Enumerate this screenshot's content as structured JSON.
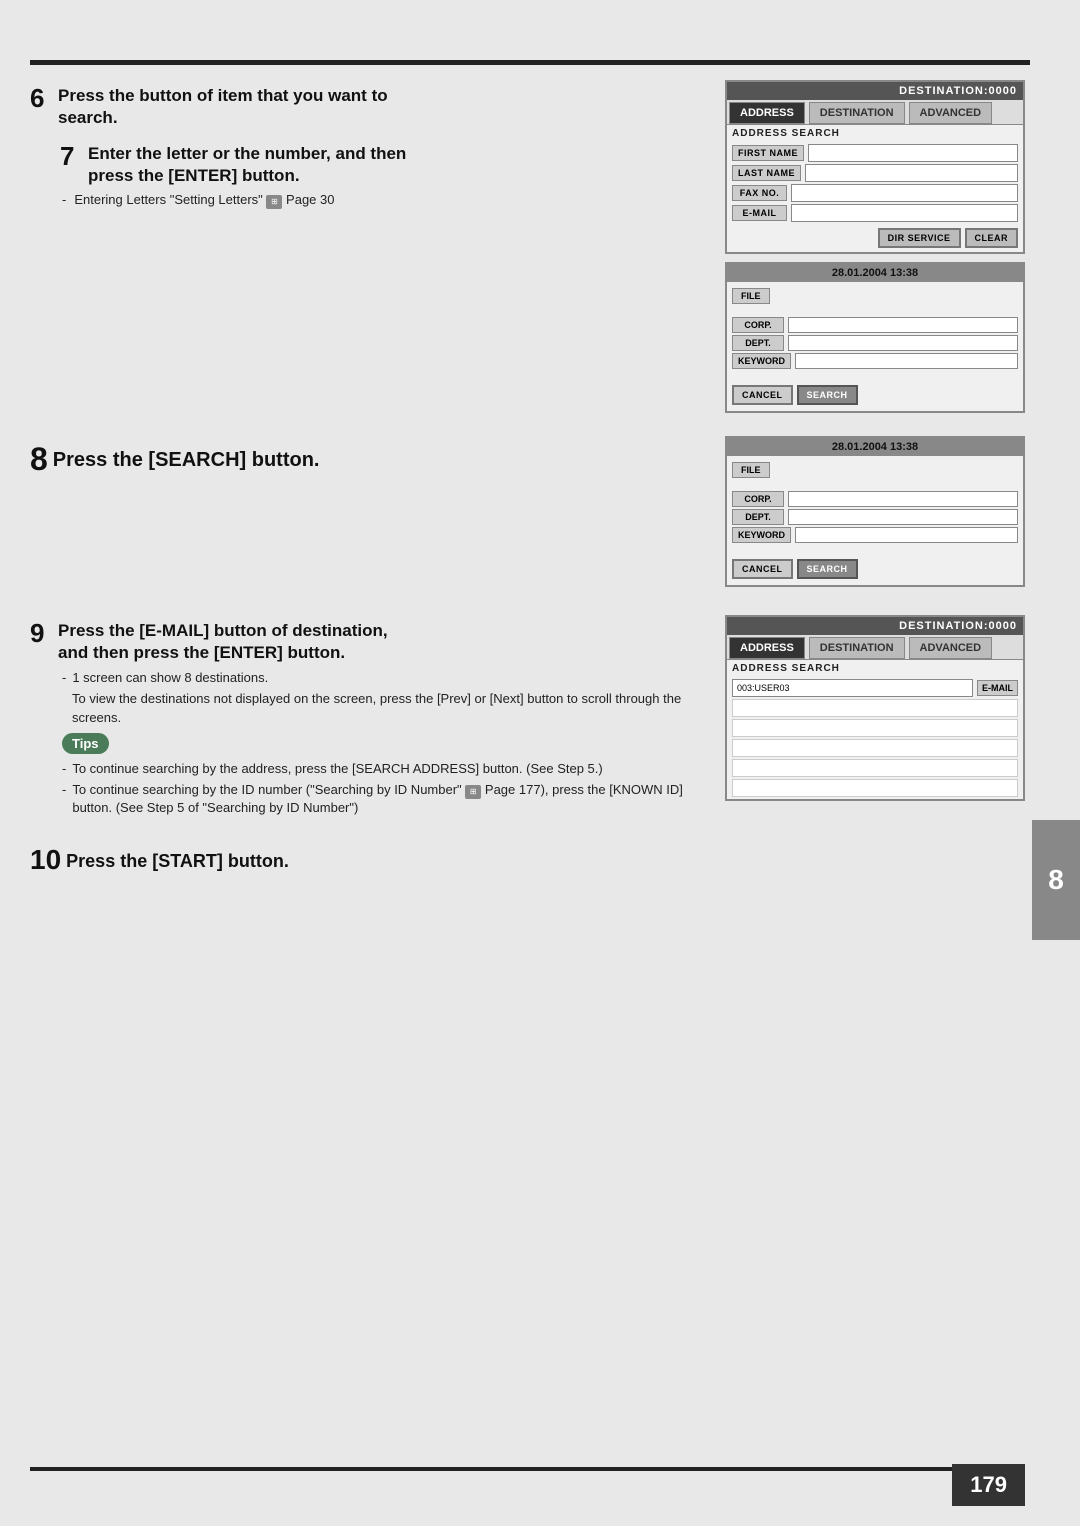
{
  "page": {
    "number": "179",
    "top_rule": true
  },
  "right_tab": {
    "label": "8"
  },
  "sections": {
    "step6": {
      "number": "6",
      "heading_line1": "Press the button of item that you want to",
      "heading_line2": "search."
    },
    "step7": {
      "number": "7",
      "heading_line1": "Enter the letter or the number, and then",
      "heading_line2": "press the [ENTER] button.",
      "note": "Entering Letters \"Setting Letters\"",
      "note_ref": "Page 30"
    },
    "step8": {
      "number": "8",
      "heading": "Press the [SEARCH] button."
    },
    "step9": {
      "number": "9",
      "heading_line1": "Press the [E-MAIL] button of destination,",
      "heading_line2": "and then press the [ENTER] button.",
      "note1": "1 screen can show 8 destinations.",
      "note1b": "To view the destinations not displayed on the screen, press the [Prev] or [Next] button to scroll through the screens.",
      "tips_label": "Tips",
      "tip1": "To continue searching by the address, press the [SEARCH ADDRESS] button. (See Step 5.)",
      "tip2": "To continue searching by the ID number (\"Searching by ID Number\"",
      "tip2b": "Page 177), press the [KNOWN ID] button. (See Step 5 of \"Searching by ID Number\")"
    },
    "step10": {
      "number": "10",
      "heading": "Press the [START] button."
    }
  },
  "panels": {
    "destination_address": {
      "header": "DESTINATION:0000",
      "tabs": [
        "ADDRESS",
        "DESTINATION",
        "ADVANCED"
      ],
      "active_tab": "ADDRESS",
      "section_title": "ADDRESS SEARCH",
      "fields": [
        {
          "label": "FIRST NAME",
          "value": ""
        },
        {
          "label": "LAST NAME",
          "value": ""
        },
        {
          "label": "FAX NO.",
          "value": ""
        },
        {
          "label": "E-MAIL",
          "value": ""
        }
      ],
      "buttons": [
        "DIR SERVICE",
        "CLEAR"
      ]
    },
    "file_search_1": {
      "date_header": "28.01.2004  13:38",
      "file_tab": "FILE",
      "fields": [
        {
          "label": "CORP.",
          "value": ""
        },
        {
          "label": "DEPT.",
          "value": ""
        },
        {
          "label": "KEYWORD",
          "value": ""
        }
      ],
      "cancel_btn": "CANCEL",
      "search_btn": "SEARCH"
    },
    "file_search_2": {
      "date_header": "28.01.2004  13:38",
      "file_tab": "FILE",
      "fields": [
        {
          "label": "CORP.",
          "value": ""
        },
        {
          "label": "DEPT.",
          "value": ""
        },
        {
          "label": "KEYWORD",
          "value": ""
        }
      ],
      "cancel_btn": "CANCEL",
      "search_btn": "SEARCH"
    },
    "destination_result": {
      "header": "DESTINATION:0000",
      "tabs": [
        "ADDRESS",
        "DESTINATION",
        "ADVANCED"
      ],
      "active_tab": "ADDRESS",
      "section_title": "ADDRESS SEARCH",
      "result_row": {
        "id": "003:USER03",
        "tag": "E-MAIL"
      }
    }
  }
}
